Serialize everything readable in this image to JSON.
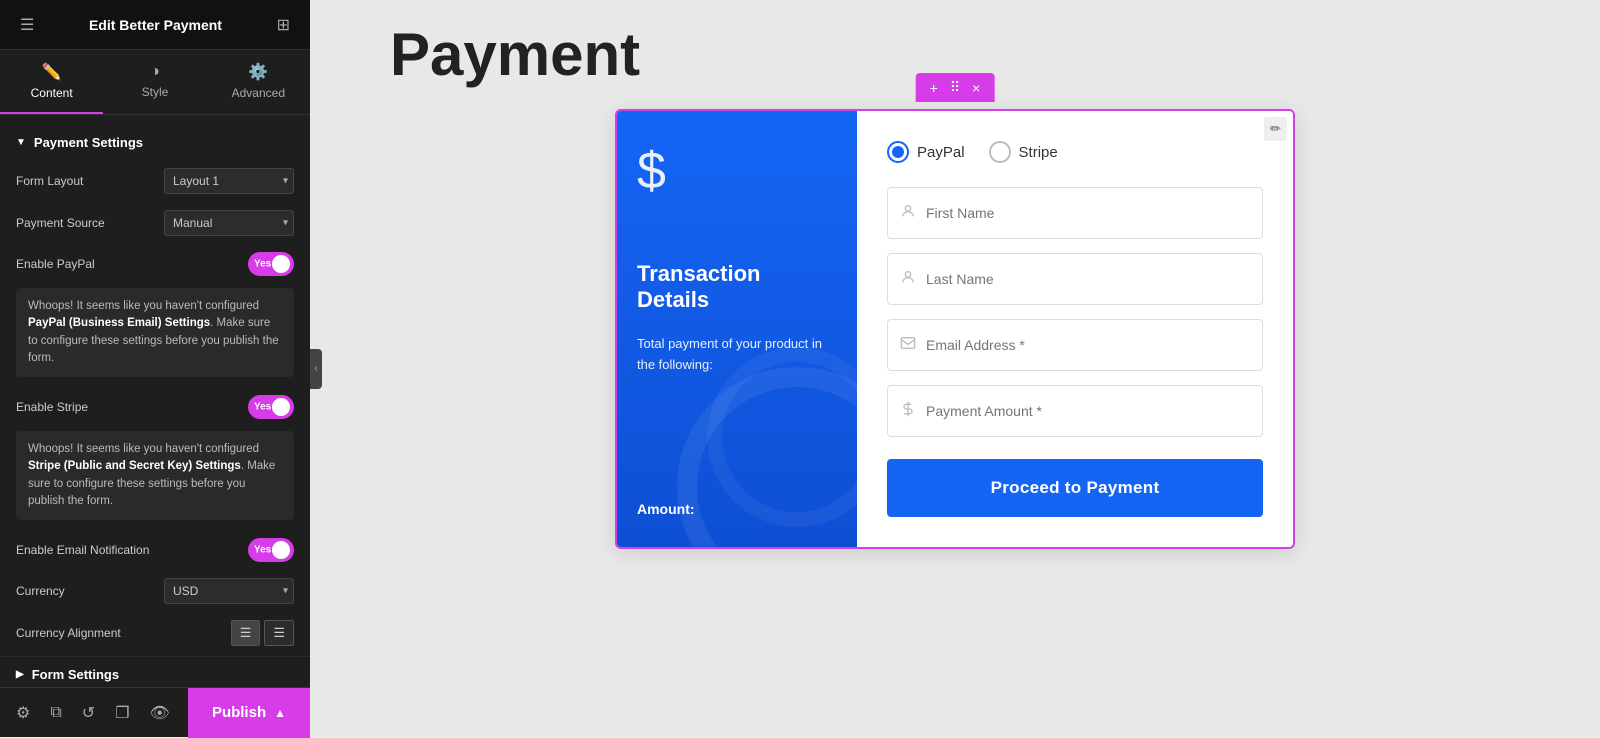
{
  "app": {
    "title": "Edit Better Payment"
  },
  "sidebar": {
    "tabs": [
      {
        "id": "content",
        "label": "Content",
        "icon": "✏️",
        "active": true
      },
      {
        "id": "style",
        "label": "Style",
        "icon": "◑",
        "active": false
      },
      {
        "id": "advanced",
        "label": "Advanced",
        "icon": "⚙️",
        "active": false
      }
    ],
    "sections": {
      "payment_settings": {
        "label": "Payment Settings",
        "expanded": true
      },
      "form_settings": {
        "label": "Form Settings",
        "expanded": false
      }
    },
    "fields": {
      "form_layout": {
        "label": "Form Layout",
        "value": "Layout 1"
      },
      "payment_source": {
        "label": "Payment Source",
        "value": "Manual"
      },
      "enable_paypal": {
        "label": "Enable PayPal",
        "toggle": true,
        "value": "Yes"
      },
      "paypal_warning": "Whoops! It seems like you haven't configured PayPal (Business Email) Settings. Make sure to configure these settings before you publish the form.",
      "enable_stripe": {
        "label": "Enable Stripe",
        "toggle": true,
        "value": "Yes"
      },
      "stripe_warning": "Whoops! It seems like you haven't configured Stripe (Public and Secret Key) Settings. Make sure to configure these settings before you publish the form.",
      "enable_email_notification": {
        "label": "Enable Email Notification",
        "toggle": true,
        "value": "Yes"
      },
      "currency": {
        "label": "Currency",
        "value": "USD"
      },
      "currency_alignment": {
        "label": "Currency Alignment"
      }
    },
    "footer": {
      "publish_label": "Publish"
    }
  },
  "preview": {
    "page_title": "Payment",
    "toolbar": {
      "add": "+",
      "move": "⠿",
      "close": "×"
    },
    "blue_panel": {
      "dollar_sign": "$",
      "transaction_title": "Transaction Details",
      "description": "Total payment of your product in the following:",
      "amount_label": "Amount:"
    },
    "form_panel": {
      "payment_options": [
        {
          "id": "paypal",
          "label": "PayPal",
          "selected": true
        },
        {
          "id": "stripe",
          "label": "Stripe",
          "selected": false
        }
      ],
      "fields": [
        {
          "id": "first_name",
          "placeholder": "First Name",
          "icon": "person"
        },
        {
          "id": "last_name",
          "placeholder": "Last Name",
          "icon": "person"
        },
        {
          "id": "email",
          "placeholder": "Email Address *",
          "icon": "email"
        },
        {
          "id": "amount",
          "placeholder": "Payment Amount *",
          "icon": "dollar"
        }
      ],
      "submit_button": "Proceed to Payment"
    }
  }
}
